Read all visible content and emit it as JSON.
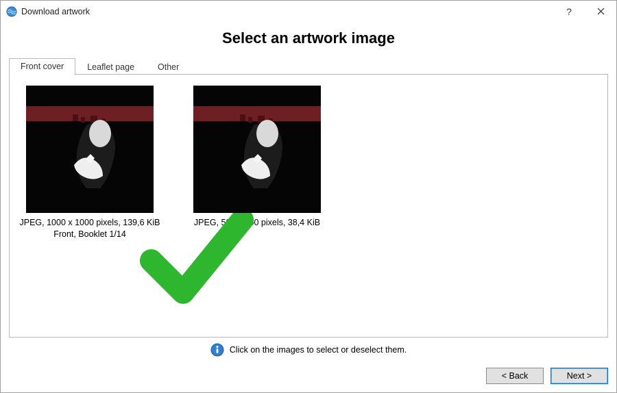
{
  "window": {
    "title": "Download artwork"
  },
  "page": {
    "heading": "Select an artwork image",
    "hint": "Click on the images to select or deselect them."
  },
  "tabs": [
    {
      "label": "Front cover",
      "active": true
    },
    {
      "label": "Leaflet page",
      "active": false
    },
    {
      "label": "Other",
      "active": false
    }
  ],
  "images": [
    {
      "selected": true,
      "line1": "JPEG, 1000 x 1000 pixels, 139,6 KiB",
      "line2": "Front, Booklet 1/14"
    },
    {
      "selected": false,
      "line1": "JPEG, 500 x 500 pixels, 38,4 KiB",
      "line2": ""
    }
  ],
  "buttons": {
    "back": "< Back",
    "next": "Next >"
  }
}
